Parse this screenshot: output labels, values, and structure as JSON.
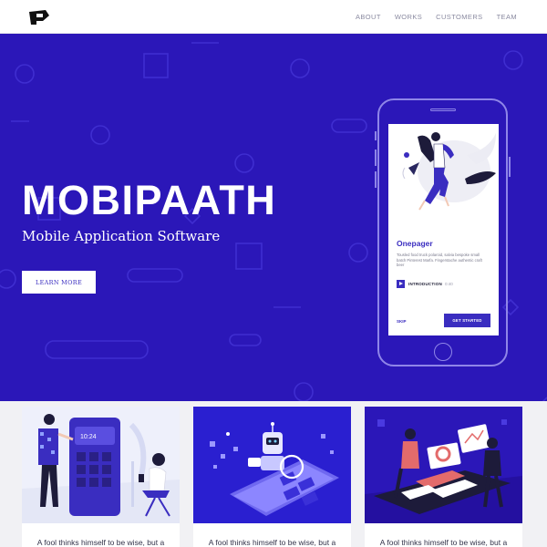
{
  "nav": {
    "links": [
      "ABOUT",
      "WORKS",
      "CUSTOMERS",
      "TEAM"
    ]
  },
  "hero": {
    "title": "MOBIPAATH",
    "subtitle": "Mobile Application Software",
    "button_label": "LEARN MORE"
  },
  "phone": {
    "title": "Onepager",
    "text": "Tousled food truck polaroid, salvia bespoke small batch Pinterest Marfa. Fingerstache authentic craft beer",
    "intro_label": "INTRODUCTION",
    "intro_duration": "0:40",
    "skip_label": "SKIP",
    "start_label": "GET STARTED"
  },
  "cards": [
    {
      "text": "A fool thinks himself to be wise, but a"
    },
    {
      "text": "A fool thinks himself to be wise, but a"
    },
    {
      "text": "A fool thinks himself to be wise, but a"
    }
  ],
  "colors": {
    "hero_bg": "#2b17b8",
    "accent": "#3a2dc0",
    "outline": "#8f86e8"
  }
}
